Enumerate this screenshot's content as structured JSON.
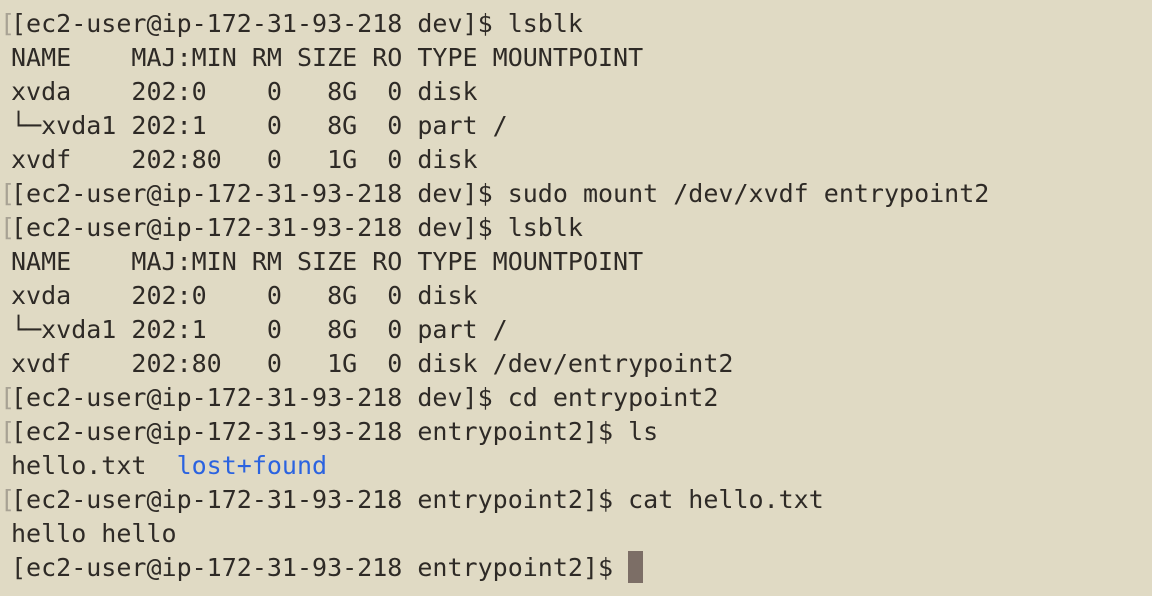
{
  "terminal": {
    "lines": [
      {
        "gutter": "[",
        "text": "[ec2-user@ip-172-31-93-218 dev]$ lsblk"
      },
      {
        "gutter": "",
        "text": "NAME    MAJ:MIN RM SIZE RO TYPE MOUNTPOINT"
      },
      {
        "gutter": "",
        "text": "xvda    202:0    0   8G  0 disk"
      },
      {
        "gutter": "",
        "text": "└─xvda1 202:1    0   8G  0 part /"
      },
      {
        "gutter": "",
        "text": "xvdf    202:80   0   1G  0 disk"
      },
      {
        "gutter": "[",
        "text": "[ec2-user@ip-172-31-93-218 dev]$ sudo mount /dev/xvdf entrypoint2"
      },
      {
        "gutter": "[",
        "text": "[ec2-user@ip-172-31-93-218 dev]$ lsblk"
      },
      {
        "gutter": "",
        "text": "NAME    MAJ:MIN RM SIZE RO TYPE MOUNTPOINT"
      },
      {
        "gutter": "",
        "text": "xvda    202:0    0   8G  0 disk"
      },
      {
        "gutter": "",
        "text": "└─xvda1 202:1    0   8G  0 part /"
      },
      {
        "gutter": "",
        "text": "xvdf    202:80   0   1G  0 disk /dev/entrypoint2"
      },
      {
        "gutter": "[",
        "text": "[ec2-user@ip-172-31-93-218 dev]$ cd entrypoint2"
      },
      {
        "gutter": "[",
        "text": "[ec2-user@ip-172-31-93-218 entrypoint2]$ ls"
      },
      {
        "gutter": "",
        "file1": "hello.txt",
        "sep": "  ",
        "dir1": "lost+found"
      },
      {
        "gutter": "[",
        "text": "[ec2-user@ip-172-31-93-218 entrypoint2]$ cat hello.txt"
      },
      {
        "gutter": "",
        "text": "hello hello"
      },
      {
        "gutter": "",
        "text": "[ec2-user@ip-172-31-93-218 entrypoint2]$ "
      }
    ]
  },
  "colors": {
    "background": "#e0dac4",
    "text": "#2e2a26",
    "directory": "#2b63e0",
    "cursor": "#7c6e66"
  }
}
